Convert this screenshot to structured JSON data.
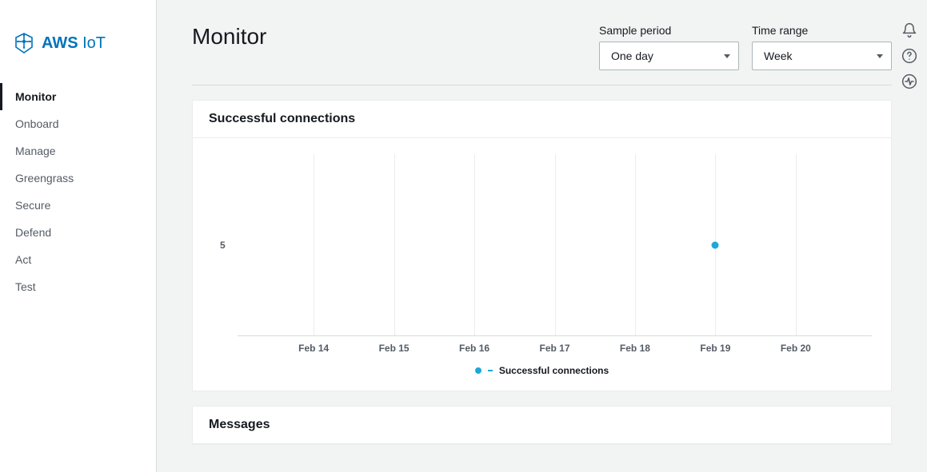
{
  "brand": {
    "bold": "AWS",
    "light": "IoT"
  },
  "sidebar": {
    "items": [
      {
        "label": "Monitor",
        "active": true
      },
      {
        "label": "Onboard"
      },
      {
        "label": "Manage"
      },
      {
        "label": "Greengrass"
      },
      {
        "label": "Secure"
      },
      {
        "label": "Defend"
      },
      {
        "label": "Act"
      },
      {
        "label": "Test"
      }
    ]
  },
  "header": {
    "title": "Monitor",
    "controls": {
      "sample_period": {
        "label": "Sample period",
        "value": "One day"
      },
      "time_range": {
        "label": "Time range",
        "value": "Week"
      }
    }
  },
  "cards": {
    "connections": {
      "title": "Successful connections",
      "legend": "Successful connections"
    },
    "messages": {
      "title": "Messages"
    }
  },
  "chart_data": {
    "type": "line",
    "title": "Successful connections",
    "xlabel": "",
    "ylabel": "",
    "ylim": [
      0,
      10
    ],
    "yticks": [
      5
    ],
    "categories": [
      "Feb 14",
      "Feb 15",
      "Feb 16",
      "Feb 17",
      "Feb 18",
      "Feb 19",
      "Feb 20"
    ],
    "series": [
      {
        "name": "Successful connections",
        "color": "#1ea7d8",
        "values": [
          null,
          null,
          null,
          null,
          null,
          5,
          null
        ]
      }
    ]
  },
  "colors": {
    "accent": "#0073bb",
    "series": "#1ea7d8"
  }
}
